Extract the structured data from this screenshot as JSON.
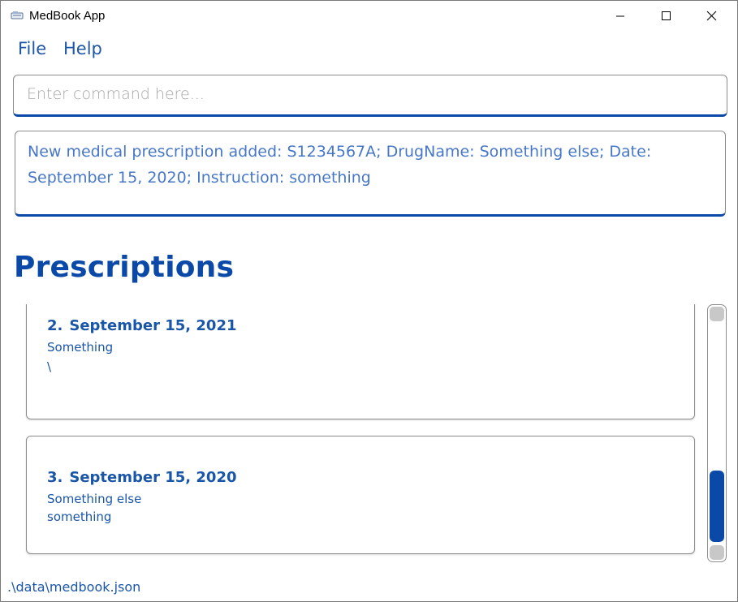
{
  "window": {
    "title": "MedBook App",
    "controls": {
      "minimize": "minimize",
      "maximize": "maximize",
      "close": "close"
    }
  },
  "menu": {
    "file_label": "File",
    "help_label": "Help"
  },
  "command": {
    "placeholder": "Enter command here...",
    "value": ""
  },
  "result": {
    "message": "New medical prescription added: S1234567A; DrugName: Something else; Date: September 15, 2020; Instruction: something"
  },
  "list": {
    "heading": "Prescriptions",
    "items": [
      {
        "index": "2.",
        "date": "September 15, 2021",
        "drug": "Something",
        "instruction": "\\"
      },
      {
        "index": "3.",
        "date": "September 15, 2020",
        "drug": "Something else",
        "instruction": "something"
      }
    ]
  },
  "status": {
    "file_path": ".\\data\\medbook.json"
  },
  "colors": {
    "accent": "#0a49a8",
    "text_blue": "#1a56a8",
    "result_text": "#4777c8"
  }
}
